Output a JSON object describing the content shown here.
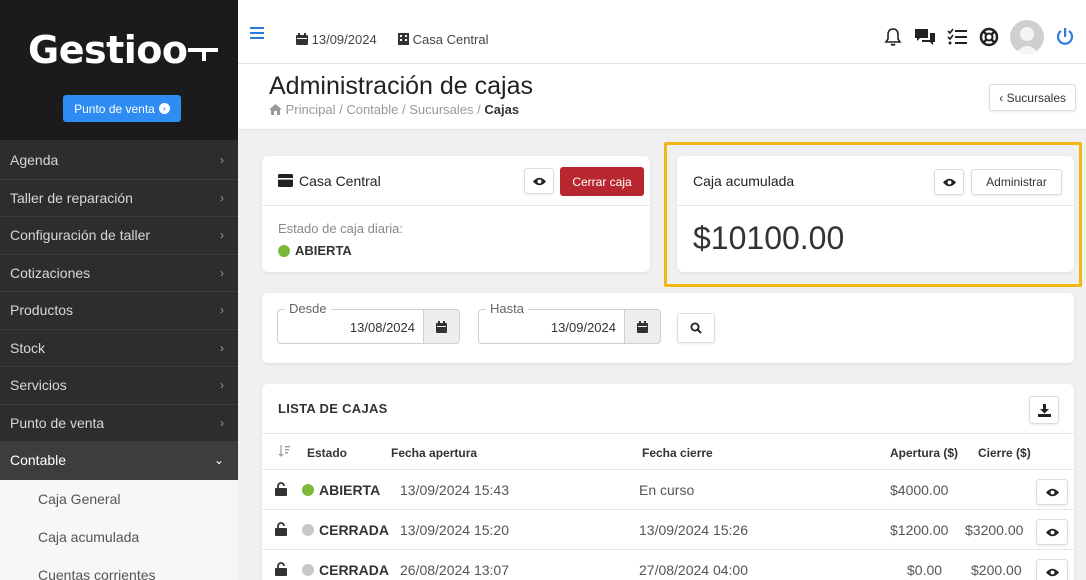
{
  "sidebar": {
    "logo": "Gestioo",
    "pos_button": "Punto de venta",
    "items": [
      {
        "label": "Agenda",
        "chevron": "›"
      },
      {
        "label": "Taller de reparación",
        "chevron": "›"
      },
      {
        "label": "Configuración de taller",
        "chevron": "›"
      },
      {
        "label": "Cotizaciones",
        "chevron": "›"
      },
      {
        "label": "Productos",
        "chevron": "›"
      },
      {
        "label": "Stock",
        "chevron": "›"
      },
      {
        "label": "Servicios",
        "chevron": "›"
      },
      {
        "label": "Punto de venta",
        "chevron": "›"
      },
      {
        "label": "Contable",
        "chevron": "⌄"
      }
    ],
    "subitems": [
      "Caja General",
      "Caja acumulada",
      "Cuentas corrientes"
    ]
  },
  "topbar": {
    "date": "13/09/2024",
    "branch": "Casa Central",
    "icons": [
      "bell-icon",
      "chat-icon",
      "tasks-icon",
      "lifebuoy-icon",
      "avatar",
      "power-icon"
    ]
  },
  "page": {
    "title": "Administración de cajas",
    "breadcrumb": [
      "Principal",
      "Contable",
      "Sucursales",
      "Cajas"
    ],
    "back_button": "‹ Sucursales"
  },
  "branch_card": {
    "title": "Casa Central",
    "close_button": "Cerrar caja",
    "status_label": "Estado de caja diaria:",
    "status": "ABIERTA"
  },
  "accum_card": {
    "title": "Caja acumulada",
    "manage_button": "Administrar",
    "amount": "$10100.00"
  },
  "filter": {
    "from_label": "Desde",
    "from_value": "13/08/2024",
    "to_label": "Hasta",
    "to_value": "13/09/2024"
  },
  "list": {
    "title": "LISTA DE CAJAS",
    "columns": [
      "Estado",
      "Fecha apertura",
      "Fecha cierre",
      "Apertura ($)",
      "Cierre ($)"
    ],
    "rows": [
      {
        "status": "ABIERTA",
        "open": "13/09/2024 15:43",
        "close": "En curso",
        "opening": "$4000.00",
        "closing": ""
      },
      {
        "status": "CERRADA",
        "open": "13/09/2024 15:20",
        "close": "13/09/2024 15:26",
        "opening": "$1200.00",
        "closing": "$3200.00"
      },
      {
        "status": "CERRADA",
        "open": "26/08/2024 13:07",
        "close": "27/08/2024 04:00",
        "opening": "$0.00",
        "closing": "$200.00"
      }
    ]
  },
  "colors": {
    "accent": "#2e8cf2",
    "danger": "#b8272f",
    "open": "#7cb83a",
    "closed": "#c8c8c8",
    "highlight": "#f2b713"
  }
}
